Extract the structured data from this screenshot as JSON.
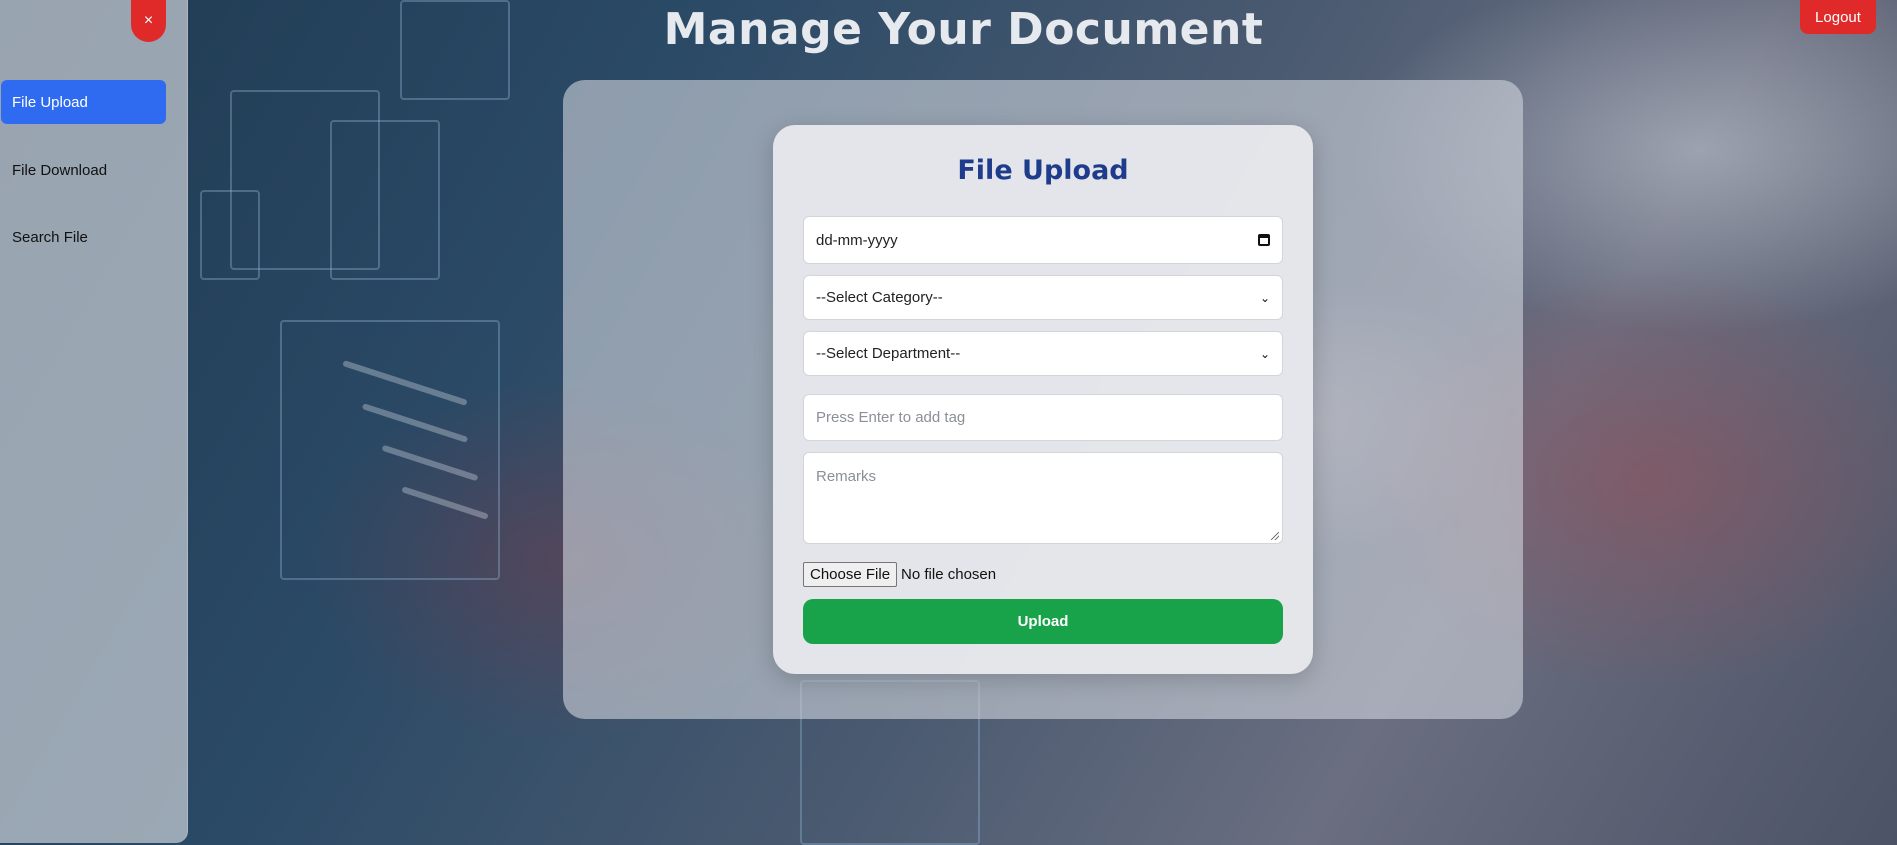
{
  "page": {
    "title": "Manage Your Document"
  },
  "header": {
    "logout_label": "Logout",
    "close_symbol": "×"
  },
  "sidebar": {
    "items": [
      {
        "label": "File Upload",
        "active": true
      },
      {
        "label": "File Download",
        "active": false
      },
      {
        "label": "Search File",
        "active": false
      }
    ]
  },
  "form": {
    "title": "File Upload",
    "date_value": "dd-mm-yyyy",
    "category_selected": "--Select Category--",
    "department_selected": "--Select Department--",
    "tag_placeholder": "Press Enter to add tag",
    "remarks_placeholder": "Remarks",
    "choose_file_label": "Choose File",
    "file_status": "No file chosen",
    "upload_label": "Upload"
  },
  "colors": {
    "active_nav": "#2f6bf0",
    "danger": "#e02a2a",
    "upload_button": "#18a34b",
    "card_title": "#1f3b8c"
  },
  "icons": [
    "close-icon",
    "calendar-icon",
    "chevron-down-icon",
    "resize-handle-icon"
  ]
}
